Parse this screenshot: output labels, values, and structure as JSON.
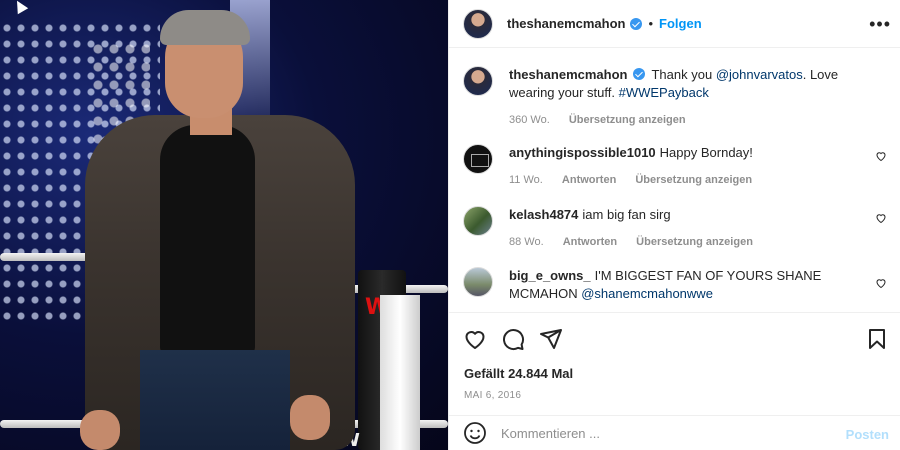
{
  "post": {
    "author": "theshanemcmahon",
    "follow_label": "Folgen",
    "dot": "•",
    "more_icon": "more-horizontal-icon"
  },
  "caption": {
    "username": "theshanemcmahon",
    "text_before": "Thank you ",
    "mention": "@johnvarvatos",
    "text_after": ". Love wearing your stuff. ",
    "hashtag": "#WWEPayback",
    "age": "360 Wo.",
    "translate": "Übersetzung anzeigen"
  },
  "comments": [
    {
      "username": "anythingispossible1010",
      "text": "Happy Bornday!",
      "age": "11 Wo.",
      "reply": "Antworten",
      "translate": "Übersetzung anzeigen"
    },
    {
      "username": "kelash4874",
      "text": "iam big fan sirg",
      "age": "88 Wo.",
      "reply": "Antworten",
      "translate": "Übersetzung anzeigen"
    },
    {
      "username": "big_e_owns_",
      "text": "I'M BIGGEST FAN OF YOURS SHANE MCMAHON ",
      "mention": "@shanemcmahonwwe"
    }
  ],
  "stats": {
    "likes": "Gefällt 24.844 Mal",
    "date": "MAI 6, 2016"
  },
  "composer": {
    "placeholder": "Kommentieren ...",
    "post_label": "Posten"
  },
  "colors": {
    "accent": "#0095f6",
    "verified": "#3897f0",
    "muted": "#8e8e8e"
  }
}
